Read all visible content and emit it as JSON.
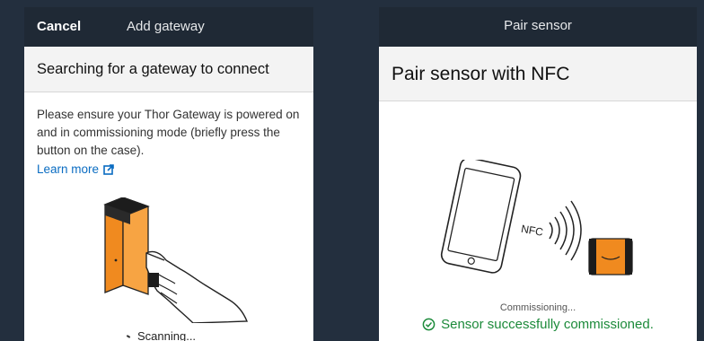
{
  "left_panel": {
    "cancel_label": "Cancel",
    "title": "Add gateway",
    "header": "Searching for a gateway to connect",
    "instructions": "Please ensure your Thor Gateway is powered on and in commissioning mode (briefly press the button on the case).",
    "learn_more": "Learn more",
    "scanning": "Scanning..."
  },
  "right_panel": {
    "title": "Pair sensor",
    "header": "Pair sensor with NFC",
    "nfc_label": "NFC",
    "commissioning": "Commissioning...",
    "success": "Sensor successfully commissioned."
  },
  "colors": {
    "background": "#232f3e",
    "topbar": "#1f2935",
    "accent_orange": "#f08a1f",
    "link_blue": "#0a6cc2",
    "success_green": "#1c8a3a"
  },
  "icons": [
    "external-link-icon",
    "spinner-icon",
    "checkmark-circle-icon"
  ]
}
